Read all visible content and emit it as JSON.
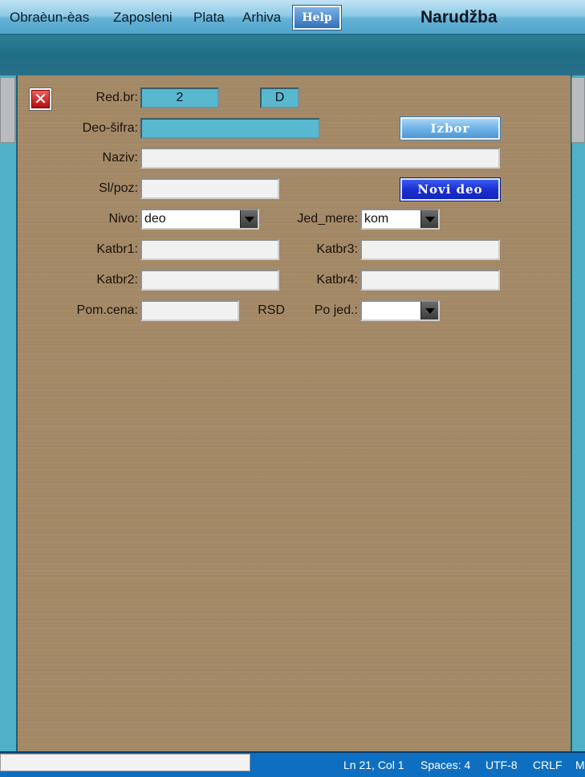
{
  "menubar": {
    "items": [
      "Obraèun-èas",
      "Zaposleni",
      "Plata",
      "Arhiva"
    ],
    "help_label": "Help",
    "window_title": "Narudžba"
  },
  "form": {
    "close_icon": "close-icon",
    "red_br": {
      "label": "Red.br:",
      "value": "2"
    },
    "d_field": {
      "value": "D"
    },
    "deo_sifra": {
      "label": "Deo-šifra:",
      "value": ""
    },
    "naziv": {
      "label": "Naziv:",
      "value": ""
    },
    "sl_poz": {
      "label": "Sl/poz:",
      "value": ""
    },
    "nivo": {
      "label": "Nivo:",
      "value": "deo"
    },
    "jed_mere": {
      "label": "Jed_mere:",
      "value": "kom"
    },
    "katbr1": {
      "label": "Katbr1:",
      "value": ""
    },
    "katbr2": {
      "label": "Katbr2:",
      "value": ""
    },
    "katbr3": {
      "label": "Katbr3:",
      "value": ""
    },
    "katbr4": {
      "label": "Katbr4:",
      "value": ""
    },
    "pom_cena": {
      "label": "Pom.cena:",
      "value": "",
      "currency": "RSD"
    },
    "po_jed": {
      "label": "Po jed.:",
      "value": ""
    },
    "izbor_label": "Izbor",
    "novi_deo_label": "Novi deo"
  },
  "statusbar": {
    "position": "Ln 21, Col 1",
    "spaces": "Spaces: 4",
    "encoding": "UTF-8",
    "line_ending": "CRLF",
    "trailing": "M"
  },
  "colors": {
    "menubar": "#66b3d6",
    "teal_band": "#1f6e86",
    "panel_wood": "#a58a67",
    "field_teal": "#58b8d0",
    "button_izbor": "#6fb2e6",
    "button_novi": "#1c2fd4",
    "statusbar": "#0e6fc1"
  }
}
